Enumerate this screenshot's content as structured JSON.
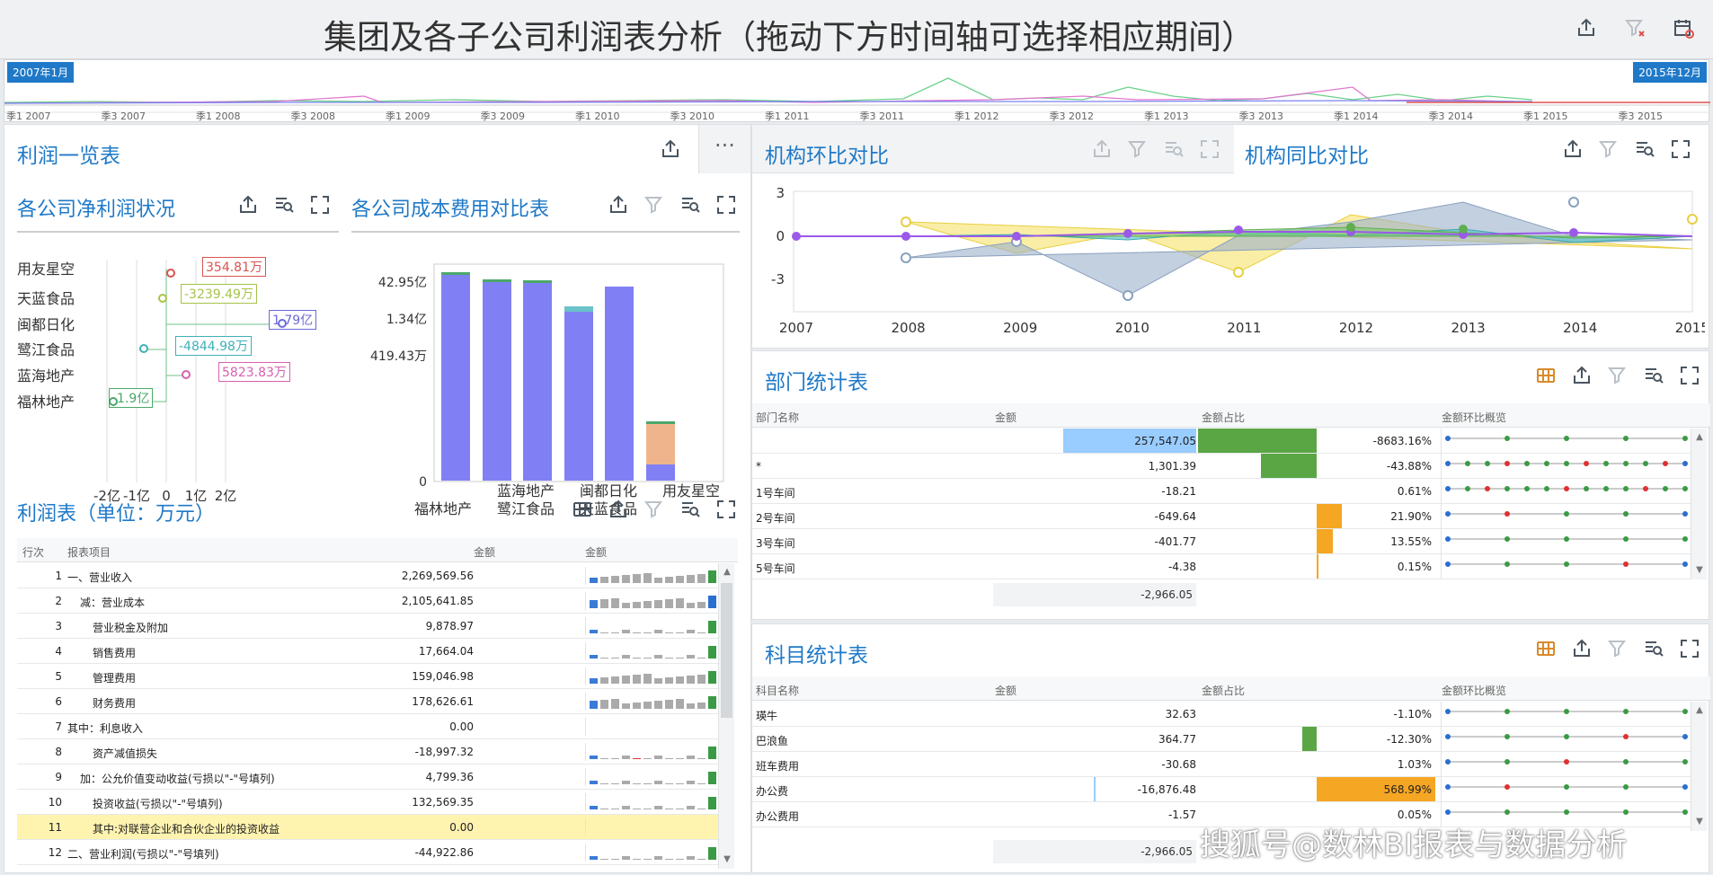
{
  "header": {
    "title": "集团及各子公司利润表分析（拖动下方时间轴可选择相应期间）"
  },
  "timeline": {
    "start_label": "2007年1月",
    "end_label": "2015年12月",
    "ticks": [
      "季1 2007",
      "季3 2007",
      "季1 2008",
      "季3 2008",
      "季1 2009",
      "季3 2009",
      "季1 2010",
      "季3 2010",
      "季1 2011",
      "季3 2011",
      "季1 2012",
      "季3 2012",
      "季1 2013",
      "季3 2013",
      "季1 2014",
      "季3 2014",
      "季1 2015",
      "季3 2015"
    ]
  },
  "profit_overview": {
    "title": "利润一览表"
  },
  "net_profit": {
    "title": "各公司净利润状况",
    "companies": [
      "用友星空",
      "天蓝食品",
      "闽都日化",
      "鹭江食品",
      "蓝海地产",
      "福林地产"
    ],
    "labels": [
      "354.81万",
      "-3239.49万",
      "1.79亿",
      "-4844.98万",
      "5823.83万",
      "-1.9亿"
    ],
    "x_ticks": [
      "-2亿",
      "-1亿",
      "0",
      "1亿",
      "2亿"
    ]
  },
  "cost_chart": {
    "title": "各公司成本费用对比表",
    "y_ticks": [
      "42.95亿",
      "1.34亿",
      "419.43万",
      "0"
    ],
    "x_row1": [
      "蓝海地产",
      "闽都日化",
      "用友星空"
    ],
    "x_row2": [
      "福林地产",
      "鹭江食品",
      "天蓝食品"
    ]
  },
  "mom_chart": {
    "title": "机构环比对比",
    "y_ticks": [
      "3",
      "0",
      "-3"
    ],
    "x_ticks": [
      "2007",
      "2008",
      "2009",
      "2010",
      "2011",
      "2012",
      "2013",
      "2014",
      "2015"
    ]
  },
  "yoy_chart": {
    "title": "机构同比对比"
  },
  "income_table": {
    "title": "利润表（单位：万元）",
    "headers": [
      "行次",
      "报表项目",
      "金额",
      "金额"
    ],
    "rows": [
      {
        "no": "1",
        "item": "一、营业收入",
        "amount": "2,269,569.56"
      },
      {
        "no": "2",
        "item": "减：营业成本",
        "amount": "2,105,641.85"
      },
      {
        "no": "3",
        "item": "营业税金及附加",
        "amount": "9,878.97"
      },
      {
        "no": "4",
        "item": "销售费用",
        "amount": "17,664.04"
      },
      {
        "no": "5",
        "item": "管理费用",
        "amount": "159,046.98"
      },
      {
        "no": "6",
        "item": "财务费用",
        "amount": "178,626.61"
      },
      {
        "no": "7",
        "item": "其中：利息收入",
        "amount": "0.00"
      },
      {
        "no": "8",
        "item": "资产减值损失",
        "amount": "-18,997.32"
      },
      {
        "no": "9",
        "item": "加：公允价值变动收益(亏损以\"-\"号填列)",
        "amount": "4,799.36"
      },
      {
        "no": "10",
        "item": "投资收益(亏损以\"-\"号填列)",
        "amount": "132,569.35"
      },
      {
        "no": "11",
        "item": "其中:对联营企业和合伙企业的投资收益",
        "amount": "0.00"
      },
      {
        "no": "12",
        "item": "二、营业利润(亏损以\"-\"号填列)",
        "amount": "-44,922.86"
      }
    ]
  },
  "dept_table": {
    "title": "部门统计表",
    "headers": [
      "部门名称",
      "金额",
      "金额占比",
      "金额环比概览"
    ],
    "rows": [
      {
        "name": "",
        "amount": "257,547.05",
        "pct": "-8683.16%"
      },
      {
        "name": "*",
        "amount": "1,301.39",
        "pct": "-43.88%"
      },
      {
        "name": "1号车间",
        "amount": "-18.21",
        "pct": "0.61%"
      },
      {
        "name": "2号车间",
        "amount": "-649.64",
        "pct": "21.90%"
      },
      {
        "name": "3号车间",
        "amount": "-401.77",
        "pct": "13.55%"
      },
      {
        "name": "5号车间",
        "amount": "-4.38",
        "pct": "0.15%"
      }
    ],
    "total": "-2,966.05"
  },
  "subject_table": {
    "title": "科目统计表",
    "headers": [
      "科目名称",
      "金额",
      "金额占比",
      "金额环比概览"
    ],
    "rows": [
      {
        "name": "瑛牛",
        "amount": "32.63",
        "pct": "-1.10%"
      },
      {
        "name": "巴浪鱼",
        "amount": "364.77",
        "pct": "-12.30%"
      },
      {
        "name": "班车费用",
        "amount": "-30.68",
        "pct": "1.03%"
      },
      {
        "name": "办公费",
        "amount": "-16,876.48",
        "pct": "568.99%"
      },
      {
        "name": "办公费用",
        "amount": "-1.57",
        "pct": "0.05%"
      }
    ],
    "total": "-2,966.05"
  },
  "watermark": "搜狐号@数林BI报表与数据分析",
  "colors": {
    "accent": "#1f79c8",
    "green": "#5aa645",
    "orange": "#f5a623",
    "blue_bar": "#8f8ff5",
    "highlight": "#fff3b0"
  }
}
